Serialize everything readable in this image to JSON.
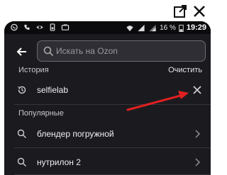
{
  "status_bar": {
    "battery": "16 %",
    "time": "19:29"
  },
  "search": {
    "placeholder": "Искать на Ozon"
  },
  "history": {
    "title": "История",
    "clear_label": "Очистить",
    "items": [
      {
        "label": "selfielab"
      }
    ]
  },
  "popular": {
    "title": "Популярные",
    "items": [
      {
        "label": "блендер погружной"
      },
      {
        "label": "нутрилон 2"
      }
    ]
  },
  "colors": {
    "background": "#1b1b1f",
    "field": "#2e2e34",
    "annotation_arrow": "#e02020"
  }
}
